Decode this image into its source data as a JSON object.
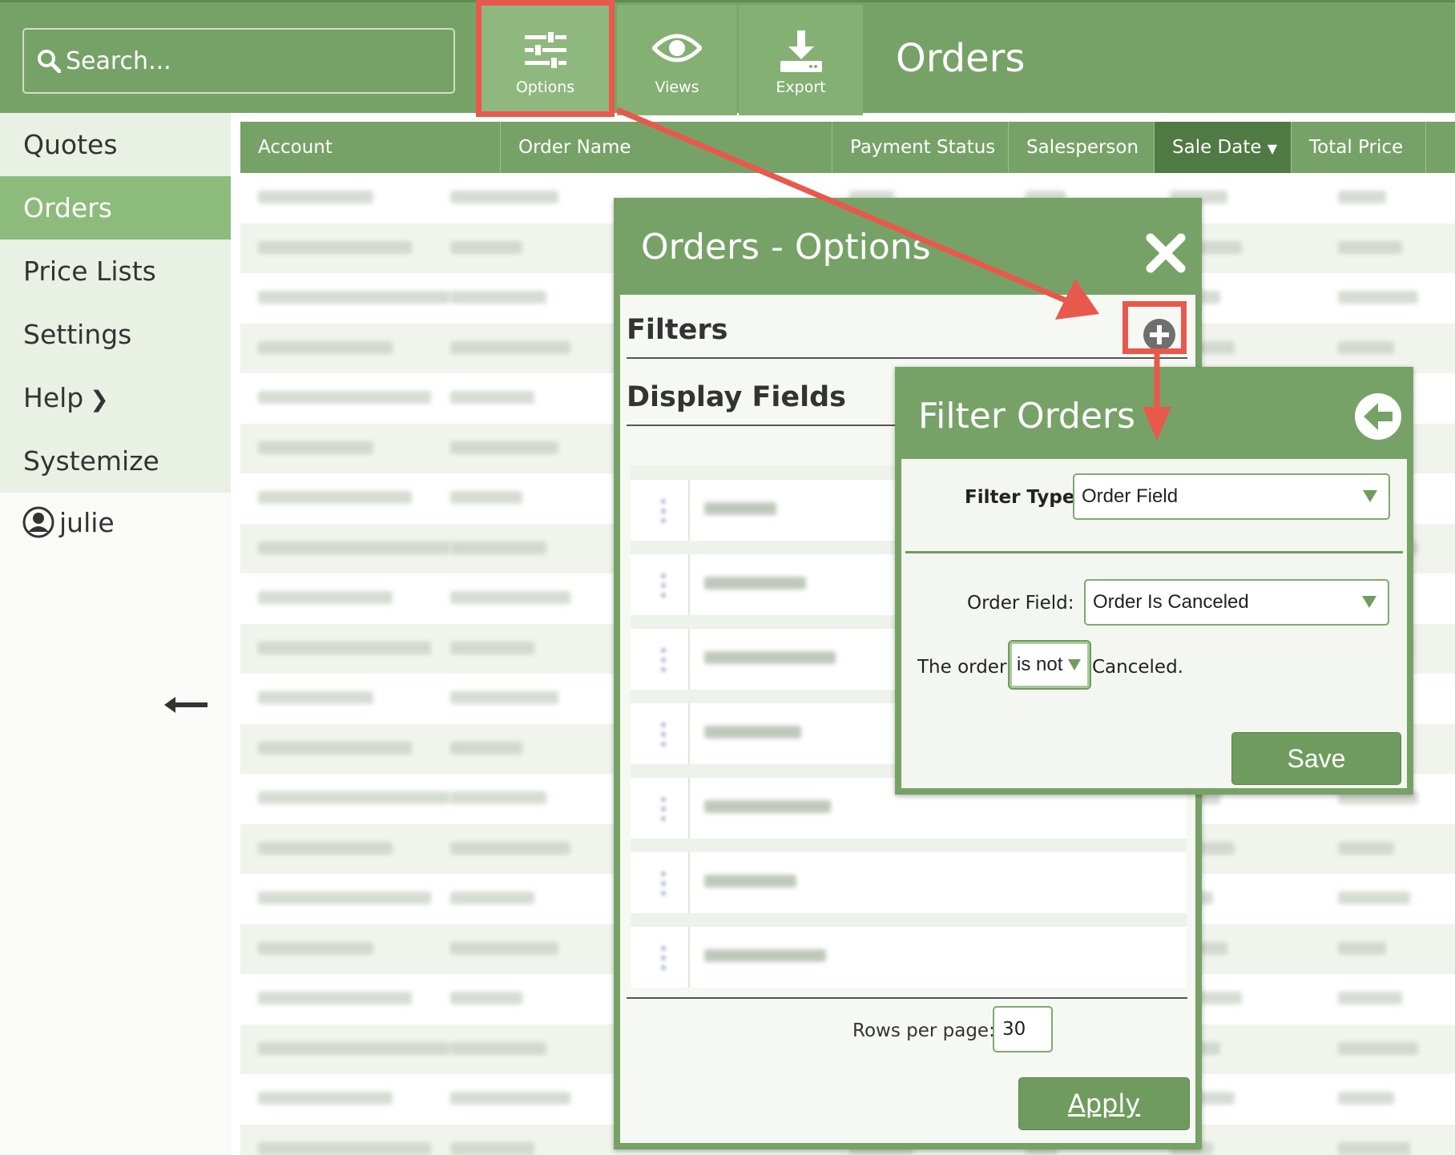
{
  "topbar": {
    "search_placeholder": "Search...",
    "options_label": "Options",
    "views_label": "Views",
    "export_label": "Export",
    "page_title": "Orders"
  },
  "sidebar": {
    "items": [
      {
        "label": "Quotes"
      },
      {
        "label": "Orders"
      },
      {
        "label": "Price Lists"
      },
      {
        "label": "Settings"
      },
      {
        "label": "Help"
      },
      {
        "label": "Systemize"
      }
    ],
    "user": "julie"
  },
  "table": {
    "columns": [
      "Account",
      "Order Name",
      "Payment Status",
      "Salesperson",
      "Sale Date",
      "Total Price"
    ]
  },
  "options_modal": {
    "title": "Orders - Options",
    "filters_heading": "Filters",
    "display_fields_heading": "Display Fields",
    "rows_per_page_label": "Rows per page:",
    "rows_per_page_value": "30",
    "apply_label": "Apply"
  },
  "filter_modal": {
    "title": "Filter Orders",
    "filter_type_label": "Filter Type:",
    "filter_type_value": "Order Field",
    "order_field_label": "Order Field:",
    "order_field_value": "Order Is Canceled",
    "sentence_prefix": "The order",
    "condition_value": "is not",
    "sentence_suffix": "Canceled.",
    "save_label": "Save"
  },
  "colors": {
    "brand_green": "#77a267",
    "dark_green": "#4f7a43",
    "highlight_red": "#e9584c"
  },
  "icons": [
    "search-icon",
    "sliders-icon",
    "eye-icon",
    "download-icon",
    "close-icon",
    "plus-circle-icon",
    "back-arrow-icon",
    "user-icon",
    "chevron-right-icon",
    "arrow-left-icon"
  ]
}
